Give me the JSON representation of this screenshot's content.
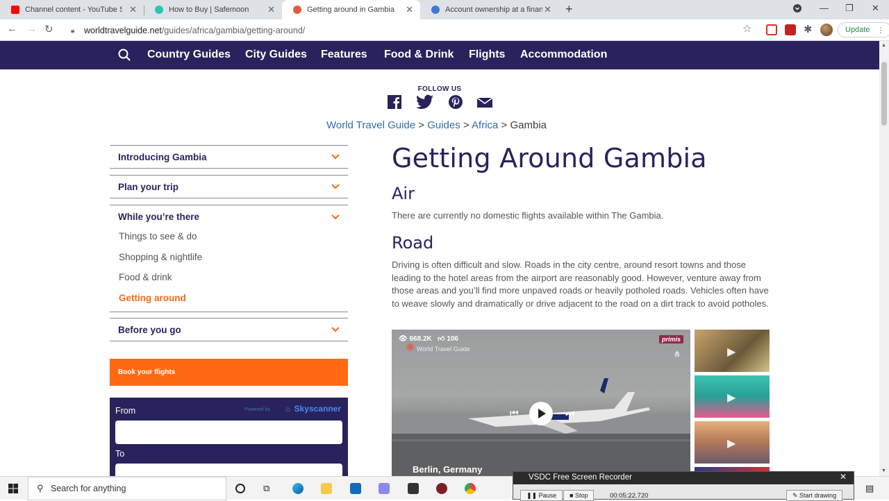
{
  "browser": {
    "tabs": [
      {
        "title": "Channel content - YouTube Studio",
        "favicon_color": "#ff0000"
      },
      {
        "title": "How to Buy | Safemoon",
        "favicon_color": "#27c6b5"
      },
      {
        "title": "Getting around in Gambia",
        "favicon_color": "#e55a3c",
        "active": true
      },
      {
        "title": "Account ownership at a financial",
        "favicon_color": "#3c78d8"
      }
    ],
    "url_domain": "worldtravelguide.net",
    "url_path": "/guides/africa/gambia/getting-around/",
    "update_label": "Update"
  },
  "site_nav": {
    "links": [
      "Country Guides",
      "City Guides",
      "Features",
      "Food & Drink",
      "Flights",
      "Accommodation"
    ]
  },
  "follow": {
    "label": "FOLLOW US",
    "icons": [
      "facebook-icon",
      "twitter-icon",
      "pinterest-icon",
      "email-icon"
    ]
  },
  "breadcrumb": {
    "items": [
      "World Travel Guide",
      "Guides",
      "Africa",
      "Gambia"
    ],
    "separator": ">"
  },
  "sidebar": {
    "sections": [
      {
        "label": "Introducing Gambia"
      },
      {
        "label": "Plan your trip"
      },
      {
        "label": "While you’re there"
      },
      {
        "label": "Before you go"
      }
    ],
    "sub_items": [
      "Things to see & do",
      "Shopping & nightlife",
      "Food & drink",
      "Getting around"
    ],
    "current_sub_item": "Getting around"
  },
  "flights_widget": {
    "book_label": "Book your flights",
    "powered_label": "Powered by",
    "brand": "Skyscanner",
    "from_label": "From",
    "to_label": "To"
  },
  "main": {
    "title": "Getting Around Gambia",
    "sections": [
      {
        "heading": "Air",
        "text": "There are currently no domestic flights available within The Gambia."
      },
      {
        "heading": "Road",
        "text": "Driving is often difficult and slow. Roads in the city centre, around resort towns and those leading to the hotel areas from the airport are reasonably good. However, venture away from those areas and you’ll find more unpaved roads or heavily potholed roads. Vehicles often have to weave slowly and dramatically or drive adjacent to the road on a dirt track to avoid potholes."
      }
    ]
  },
  "video": {
    "views": "668.2K",
    "likes": "106",
    "brand": "primis",
    "logo_text": "World Travel Guide",
    "caption": "Berlin, Germany"
  },
  "taskbar": {
    "search_placeholder": "Search for anything"
  },
  "recorder": {
    "title": "VSDC Free Screen Recorder",
    "pause_label": "Pause",
    "stop_label": "Stop",
    "time": "00:05:22.720",
    "draw_label": "Start drawing"
  }
}
